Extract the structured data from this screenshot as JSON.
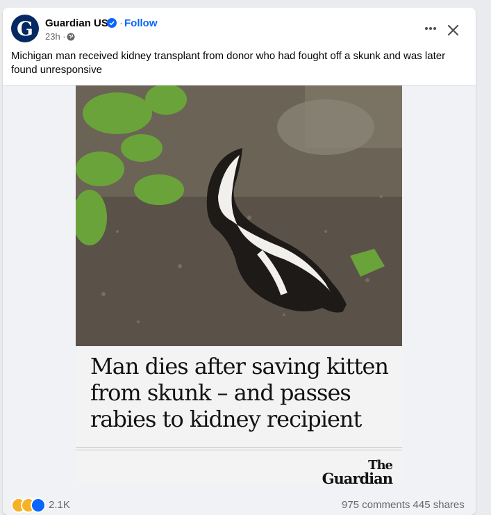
{
  "post": {
    "page_name": "Guardian US",
    "follow_label": "Follow",
    "separator": "·",
    "time": "23h ·",
    "caption": "Michigan man received kidney transplant from donor who had fought off a skunk and was later found unresponsive"
  },
  "article": {
    "headline": "Man dies after saving kitten from skunk – and passes rabies to kidney recipient",
    "logo_the": "The",
    "logo_guardian": "Guardian"
  },
  "engagement": {
    "reactions_count": "2.1K",
    "comments_shares": "975 comments  445 shares"
  },
  "icons": {
    "verified": "verified-badge-icon",
    "privacy": "globe-icon",
    "more": "more-options-icon",
    "close": "close-icon"
  },
  "colors": {
    "brand_blue": "#0866ff",
    "guardian_navy": "#052962",
    "muted_text": "#65676b"
  }
}
